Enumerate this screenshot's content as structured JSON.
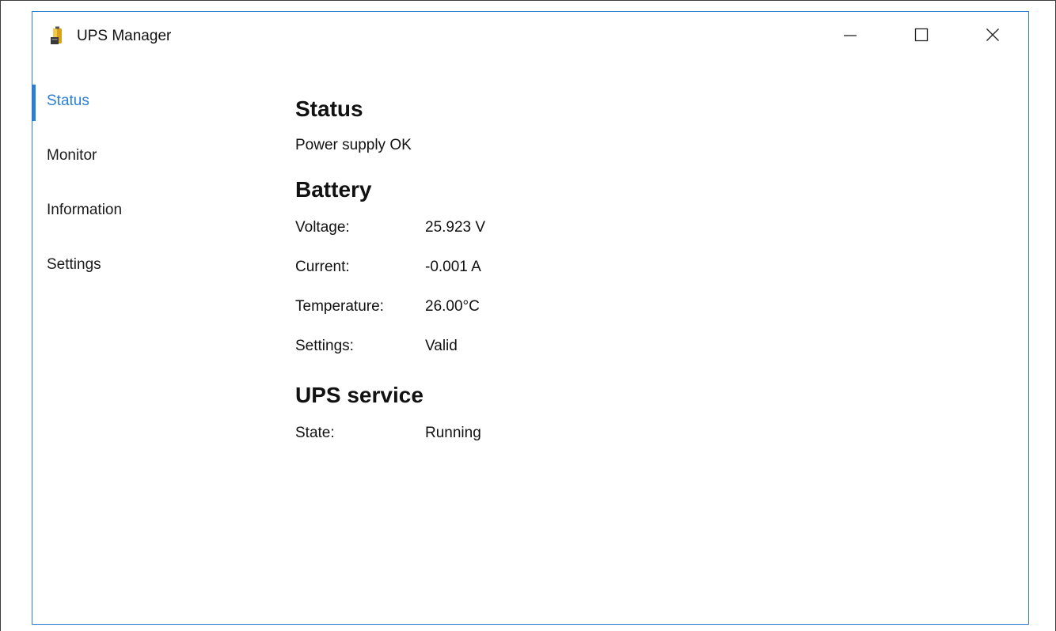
{
  "window": {
    "title": "UPS Manager",
    "accent_color": "#2a7fd4",
    "controls": {
      "minimize_icon": "minimize-icon",
      "maximize_icon": "maximize-icon",
      "close_icon": "close-icon"
    }
  },
  "sidebar": {
    "items": [
      {
        "label": "Status",
        "active": true
      },
      {
        "label": "Monitor",
        "active": false
      },
      {
        "label": "Information",
        "active": false
      },
      {
        "label": "Settings",
        "active": false
      }
    ]
  },
  "status": {
    "heading": "Status",
    "text": "Power supply OK"
  },
  "battery": {
    "heading": "Battery",
    "rows": [
      {
        "label": "Voltage:",
        "value": "25.923 V"
      },
      {
        "label": "Current:",
        "value": "-0.001 A"
      },
      {
        "label": "Temperature:",
        "value": "26.00°C"
      },
      {
        "label": "Settings:",
        "value": "Valid"
      }
    ]
  },
  "ups_service": {
    "heading": "UPS service",
    "rows": [
      {
        "label": "State:",
        "value": "Running"
      }
    ]
  }
}
